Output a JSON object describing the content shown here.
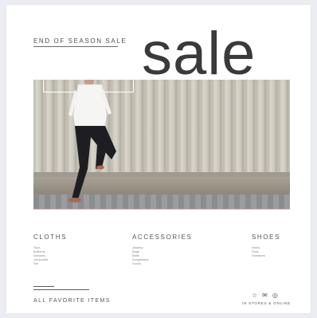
{
  "poster": {
    "tagline": "END OF SEASON SALE",
    "headline": "sale"
  },
  "categories": [
    {
      "title": "CLOTHS",
      "items": [
        "Tops",
        "Bottoms",
        "Dresses",
        "Jumpsuits",
        "Set"
      ]
    },
    {
      "title": "ACCESSORIES",
      "items": [
        "Jewelry",
        "Bags",
        "Belts",
        "Sunglasses",
        "Socks"
      ]
    },
    {
      "title": "SHOES",
      "items": [
        "Heels",
        "Flats",
        "Sneakers"
      ]
    }
  ],
  "footer": {
    "label": "ALL FAVORITE ITEMS",
    "store_label": "IN STORES & ONLINE",
    "icons": [
      "star-icon",
      "mail-icon",
      "globe-icon"
    ]
  },
  "colors": {
    "background": "#ebedf2",
    "accent_line": "#e8a8ad"
  }
}
